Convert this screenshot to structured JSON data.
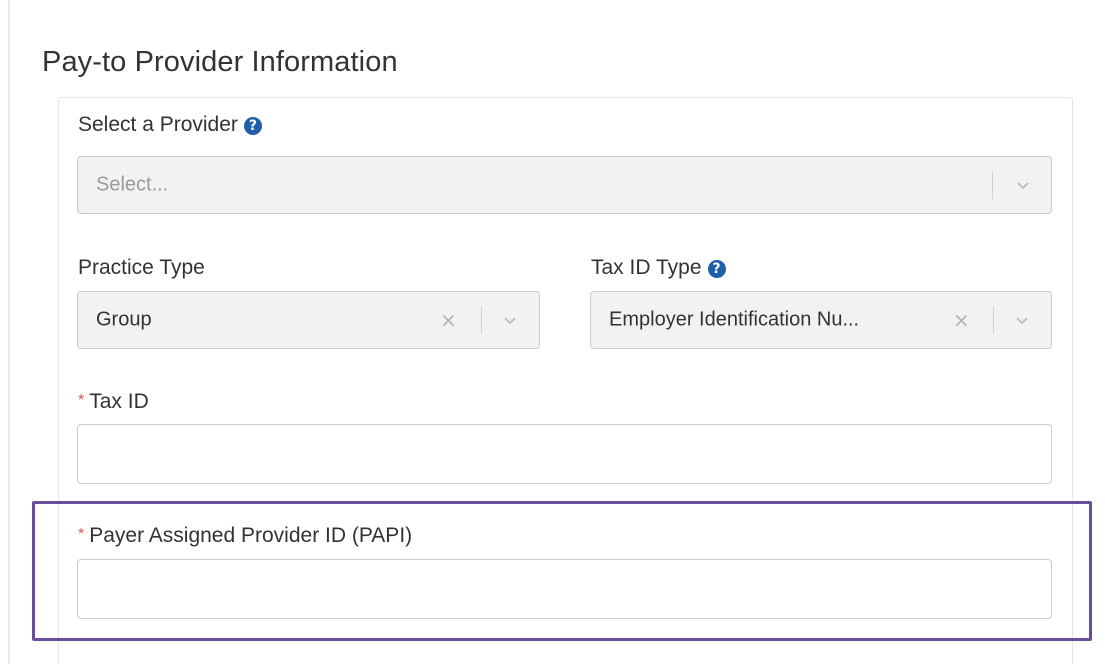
{
  "section": {
    "title": "Pay-to Provider Information"
  },
  "provider": {
    "label": "Select a Provider",
    "placeholder": "Select..."
  },
  "practice_type": {
    "label": "Practice Type",
    "value": "Group"
  },
  "tax_id_type": {
    "label": "Tax ID Type",
    "value": "Employer Identification Nu..."
  },
  "tax_id": {
    "required_mark": "*",
    "label": "Tax ID",
    "value": ""
  },
  "papi": {
    "required_mark": "*",
    "label": "Payer Assigned Provider ID (PAPI)",
    "value": ""
  },
  "icons": {
    "help": "question-circle-icon",
    "clear": "clear-x-icon",
    "dropdown": "chevron-down-icon"
  },
  "colors": {
    "help_icon": "#1f5fa8",
    "required": "#e0555b",
    "highlight_border": "#6b4e9b",
    "select_background": "#f2f2f2"
  }
}
